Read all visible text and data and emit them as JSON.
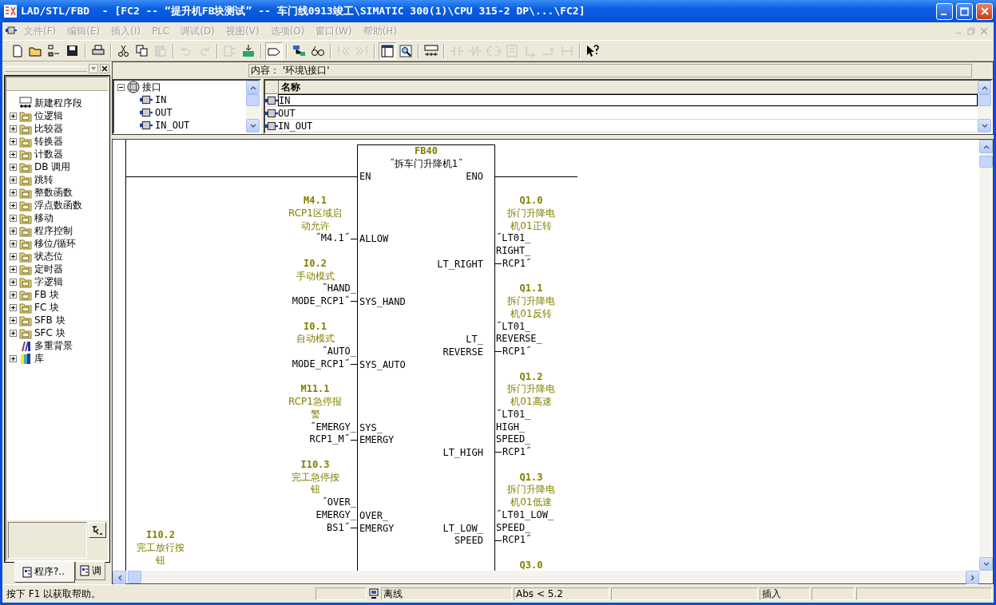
{
  "window": {
    "title": "LAD/STL/FBD  - [FC2 -- “提升机FB块测试” -- 车门线0913竣工\\SIMATIC 300(1)\\CPU 315-2 DP\\...\\FC2]"
  },
  "menu": [
    {
      "label": "文件(F)",
      "disabled": true
    },
    {
      "label": "编辑(E)",
      "disabled": true
    },
    {
      "label": "插入(I)",
      "disabled": true
    },
    {
      "label": "PLC",
      "disabled": true
    },
    {
      "label": "调试(D)",
      "disabled": true
    },
    {
      "label": "视图(V)",
      "disabled": true
    },
    {
      "label": "选项(O)",
      "disabled": true
    },
    {
      "label": "窗口(W)",
      "disabled": true
    },
    {
      "label": "帮助(H)",
      "disabled": true
    }
  ],
  "toolbar": [
    {
      "kind": "page",
      "disabled": false
    },
    {
      "kind": "folder",
      "disabled": false
    },
    {
      "kind": "nodes",
      "disabled": false
    },
    {
      "kind": "disk",
      "disabled": false
    },
    {
      "kind": "sep"
    },
    {
      "kind": "printer",
      "disabled": false
    },
    {
      "kind": "sep"
    },
    {
      "kind": "scissors",
      "disabled": false
    },
    {
      "kind": "copy",
      "disabled": false
    },
    {
      "kind": "paste",
      "disabled": true
    },
    {
      "kind": "sep"
    },
    {
      "kind": "undo",
      "disabled": true
    },
    {
      "kind": "redo",
      "disabled": true
    },
    {
      "kind": "sep"
    },
    {
      "kind": "blockref",
      "disabled": true
    },
    {
      "kind": "download",
      "disabled": false
    },
    {
      "kind": "sep"
    },
    {
      "kind": "overview",
      "disabled": false,
      "pressed": true
    },
    {
      "kind": "sep"
    },
    {
      "kind": "network",
      "disabled": false
    },
    {
      "kind": "glasses",
      "disabled": false
    },
    {
      "kind": "sep"
    },
    {
      "kind": "prev",
      "disabled": true
    },
    {
      "kind": "next",
      "disabled": true
    },
    {
      "kind": "sep"
    },
    {
      "kind": "panel",
      "disabled": false,
      "pressed": true
    },
    {
      "kind": "zoom",
      "disabled": false
    },
    {
      "kind": "sep"
    },
    {
      "kind": "netinsert",
      "disabled": false
    },
    {
      "kind": "sep"
    },
    {
      "kind": "contact",
      "disabled": true
    },
    {
      "kind": "nccontact",
      "disabled": true
    },
    {
      "kind": "coil",
      "disabled": true
    },
    {
      "kind": "emptybox",
      "disabled": true
    },
    {
      "kind": "branchopen",
      "disabled": true
    },
    {
      "kind": "branchclose",
      "disabled": true
    },
    {
      "kind": "connect",
      "disabled": true
    },
    {
      "kind": "sep"
    },
    {
      "kind": "helparrow",
      "disabled": false
    }
  ],
  "catalog": {
    "items": [
      {
        "kind": "network",
        "label": "新建程序段"
      },
      {
        "kind": "folder",
        "label": "位逻辑",
        "expanded": false
      },
      {
        "kind": "folder",
        "label": "比较器",
        "expanded": false
      },
      {
        "kind": "folder",
        "label": "转换器",
        "expanded": false
      },
      {
        "kind": "folder",
        "label": "计数器",
        "expanded": false
      },
      {
        "kind": "folder",
        "label": "DB 调用",
        "expanded": false
      },
      {
        "kind": "folder",
        "label": "跳转",
        "expanded": false
      },
      {
        "kind": "folder",
        "label": "整数函数",
        "expanded": false
      },
      {
        "kind": "folder",
        "label": "浮点数函数",
        "expanded": false
      },
      {
        "kind": "folder",
        "label": "移动",
        "expanded": false
      },
      {
        "kind": "folder",
        "label": "程序控制",
        "expanded": false
      },
      {
        "kind": "folder",
        "label": "移位/循环",
        "expanded": false
      },
      {
        "kind": "folder",
        "label": "状态位",
        "expanded": false
      },
      {
        "kind": "folder",
        "label": "定时器",
        "expanded": false
      },
      {
        "kind": "folder",
        "label": "字逻辑",
        "expanded": false
      },
      {
        "kind": "folder",
        "label": "FB 块",
        "expanded": false
      },
      {
        "kind": "folder",
        "label": "FC 块",
        "expanded": false
      },
      {
        "kind": "folder",
        "label": "SFB 块",
        "expanded": false
      },
      {
        "kind": "folder",
        "label": "SFC 块",
        "expanded": false
      },
      {
        "kind": "multi",
        "label": "多重背景"
      },
      {
        "kind": "library",
        "label": "库",
        "expanded": false
      }
    ],
    "tabs": [
      {
        "label": "程序?..",
        "selected": true
      },
      {
        "label": "调",
        "selected": false
      }
    ]
  },
  "interface": {
    "content": "内容： '环境\\接口'",
    "tree": {
      "label": "接口",
      "expanded": true,
      "children": [
        {
          "label": "IN"
        },
        {
          "label": "OUT"
        },
        {
          "label": "IN_OUT"
        }
      ]
    },
    "table": {
      "columns": [
        "名称"
      ],
      "rows": [
        {
          "name": "IN",
          "selected": true
        },
        {
          "name": "OUT",
          "selected": false
        },
        {
          "name": "IN_OUT",
          "selected": false
        }
      ]
    }
  },
  "ladder": {
    "block": {
      "number": "FB40",
      "name": "˝拆车门升降机1˝",
      "en": "EN",
      "eno": "ENO"
    },
    "inputs": [
      {
        "address": "M4.1",
        "comment": [
          "RCP1区域启",
          "动允许"
        ],
        "symbol": [
          "˝M4.1˝"
        ],
        "pin": [
          "ALLOW"
        ]
      },
      {
        "address": "I0.2",
        "comment": [
          "手动模式"
        ],
        "symbol": [
          "˝HAND_",
          "MODE_RCP1˝"
        ],
        "pin": [
          "SYS_HAND"
        ]
      },
      {
        "address": "I0.1",
        "comment": [
          "自动模式"
        ],
        "symbol": [
          "˝AUTO_",
          "MODE_RCP1˝"
        ],
        "pin": [
          "SYS_AUTO"
        ]
      },
      {
        "address": "M11.1",
        "comment": [
          "RCP1急停报",
          "警"
        ],
        "symbol": [
          "˝EMERGY_",
          "RCP1_M˝"
        ],
        "pin": [
          "SYS_",
          "EMERGY"
        ]
      },
      {
        "address": "I10.3",
        "comment": [
          "完工急停按",
          "钮"
        ],
        "symbol": [
          "˝OVER_",
          "EMERGY_",
          "BS1˝"
        ],
        "pin": [
          "OVER_",
          "EMERGY"
        ]
      }
    ],
    "outputs": [
      {
        "address": "Q1.0",
        "comment": [
          "拆门升降电",
          "机01正转"
        ],
        "symbol": [
          "˝LT01_",
          "RIGHT_",
          "RCP1˝"
        ],
        "pin": [
          "LT_RIGHT"
        ]
      },
      {
        "address": "Q1.1",
        "comment": [
          "拆门升降电",
          "机01反转"
        ],
        "symbol": [
          "˝LT01_",
          "REVERSE_",
          "RCP1˝"
        ],
        "pin": [
          "LT_",
          "REVERSE"
        ]
      },
      {
        "address": "Q1.2",
        "comment": [
          "拆门升降电",
          "机01高速"
        ],
        "symbol": [
          "˝LT01_",
          "HIGH_",
          "SPEED_",
          "RCP1˝"
        ],
        "pin": [
          "LT_HIGH"
        ]
      },
      {
        "address": "Q1.3",
        "comment": [
          "拆门升降电",
          "机01低速"
        ],
        "symbol": [
          "˝LT01_LOW_",
          "SPEED_",
          "RCP1˝"
        ],
        "pin": [
          "LT_LOW_",
          "SPEED"
        ]
      },
      {
        "address": "Q3.0"
      }
    ],
    "next": {
      "address": "I10.2",
      "comment": [
        "完工放行按",
        "钮"
      ]
    }
  },
  "status_bar": {
    "help": "按下 F1 以获取帮助。",
    "mode": "离线",
    "position": "Abs < 5.2",
    "insert": "插入"
  }
}
